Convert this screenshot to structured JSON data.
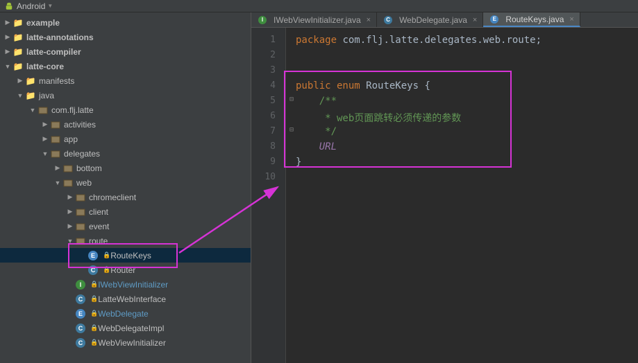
{
  "toolbar": {
    "mode": "Android"
  },
  "tree": {
    "example": "example",
    "latteAnnotations": "latte-annotations",
    "latteCompiler": "latte-compiler",
    "latteCore": "latte-core",
    "manifests": "manifests",
    "java": "java",
    "pkg": "com.flj.latte",
    "activities": "activities",
    "app": "app",
    "delegates": "delegates",
    "bottom": "bottom",
    "web": "web",
    "chromeclient": "chromeclient",
    "client": "client",
    "event": "event",
    "route": "route",
    "routeKeys": "RouteKeys",
    "router": "Router",
    "iweb": "IWebViewInitializer",
    "latteWeb": "LatteWebInterface",
    "webDelegate": "WebDelegate",
    "webDelegateImpl": "WebDelegateImpl",
    "webViewInit": "WebViewInitializer"
  },
  "tabs": {
    "t1": "IWebViewInitializer.java",
    "t2": "WebDelegate.java",
    "t3": "RouteKeys.java"
  },
  "code": {
    "l1a": "package ",
    "l1b": "com.flj.latte.delegates.web.route;",
    "l4a": "public enum ",
    "l4b": "RouteKeys {",
    "l5": "/**",
    "l6": " * web页面跳转必须传递的参数",
    "l7": " */",
    "l8": "URL",
    "l9": "}"
  },
  "gutter": [
    "1",
    "2",
    "3",
    "4",
    "5",
    "6",
    "7",
    "8",
    "9",
    "10"
  ]
}
